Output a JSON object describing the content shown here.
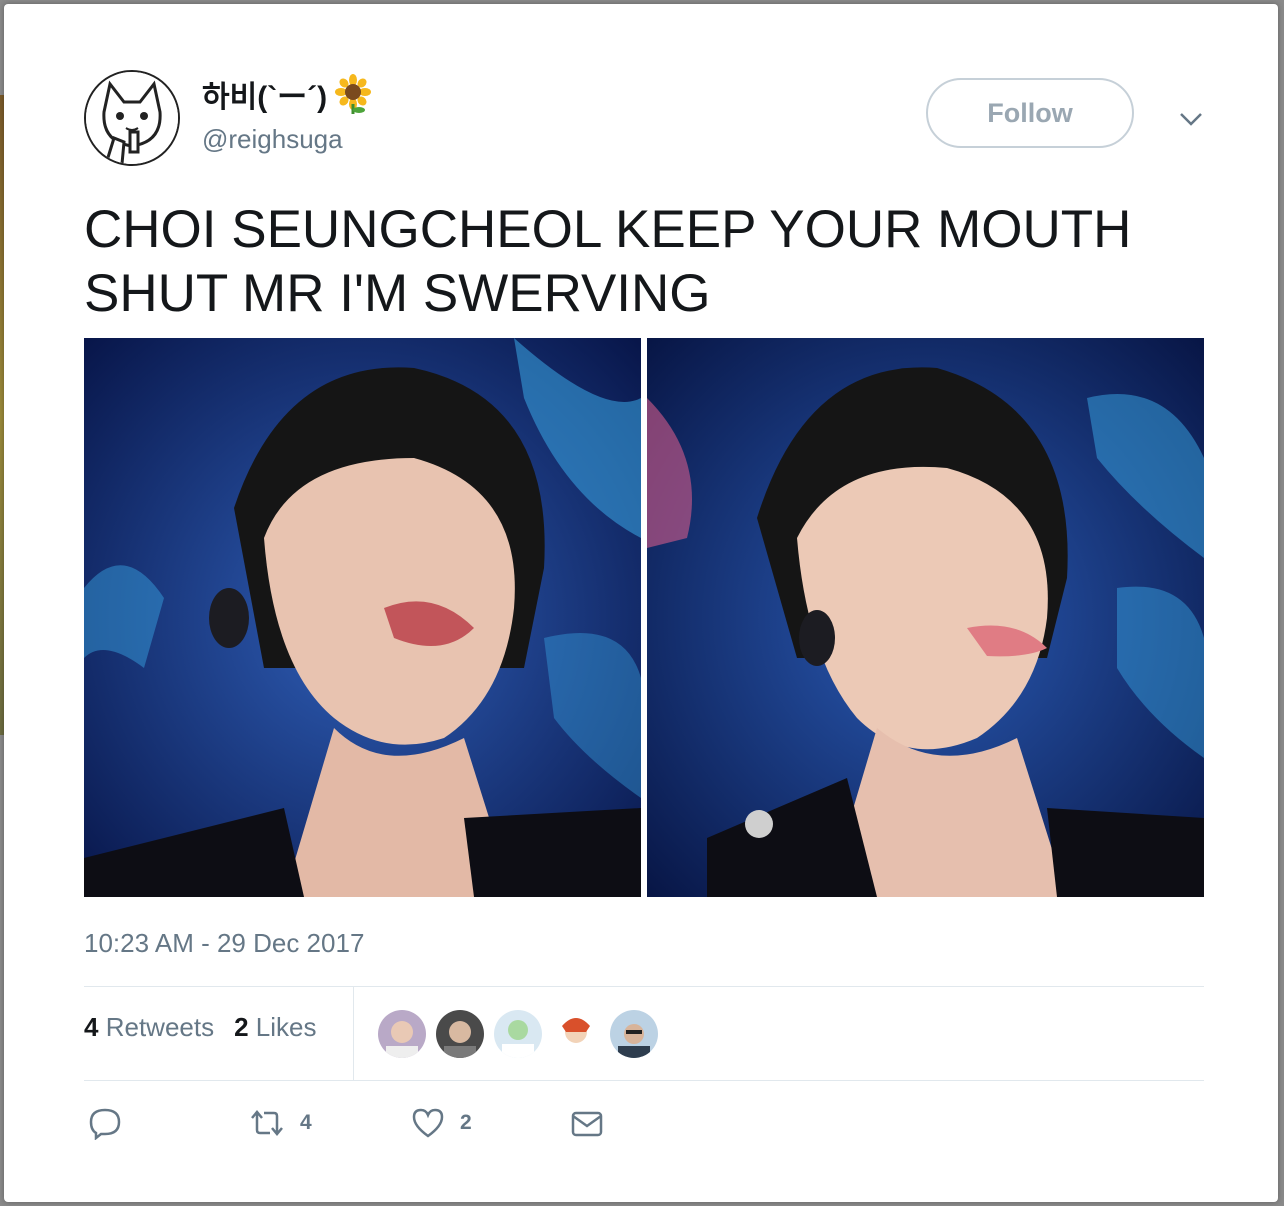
{
  "tweet": {
    "display_name": "하비(`ー´)",
    "name_emoji": "sunflower-icon",
    "handle": "@reighsuga",
    "text": "CHOI SEUNGCHEOL KEEP YOUR MOUTH\nSHUT MR I'M SWERVING",
    "timestamp": "10:23 AM - 29 Dec 2017",
    "follow_label": "Follow",
    "stats": {
      "retweets_count": "4",
      "retweets_label": "Retweets",
      "likes_count": "2",
      "likes_label": "Likes"
    },
    "actions": {
      "reply_icon": "reply-icon",
      "retweet_icon": "retweet-icon",
      "retweet_count": "4",
      "like_icon": "heart-icon",
      "like_count": "2",
      "dm_icon": "envelope-icon"
    }
  },
  "colors": {
    "text_primary": "#14171a",
    "text_secondary": "#657786",
    "follow_border": "#c6d0d8",
    "divider": "#e1e8ed"
  }
}
